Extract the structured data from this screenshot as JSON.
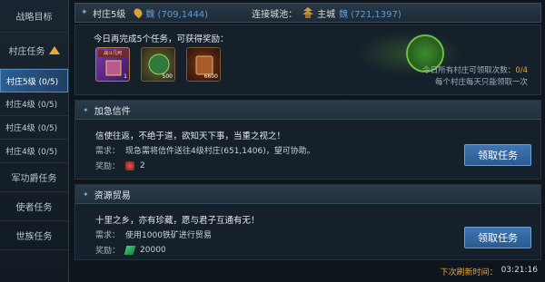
{
  "sidebar": {
    "items": [
      {
        "label": "战略目标"
      },
      {
        "label": "村庄任务"
      },
      {
        "label": "村庄5级 (0/5)",
        "active": true
      },
      {
        "label": "村庄4级 (0/5)"
      },
      {
        "label": "村庄4级 (0/5)"
      },
      {
        "label": "村庄4级 (0/5)"
      },
      {
        "label": "军功爵任务"
      },
      {
        "label": "使者任务"
      },
      {
        "label": "世族任务"
      }
    ]
  },
  "header": {
    "village": "村庄5级",
    "village_coord": "魏 (709,1444)",
    "connect_label": "连接城池：",
    "city": "主城",
    "city_coord": "魏 (721,1397)"
  },
  "daily": {
    "title": "今日再完成5个任务，可获得奖励：",
    "rewards": [
      {
        "label": "战斗几何",
        "count": "1"
      },
      {
        "label": "",
        "count": "500"
      },
      {
        "label": "",
        "count": "6600"
      }
    ],
    "count_label": "今日所有村庄可领取次数：",
    "count_value": "0/4",
    "note": "每个村庄每天只能领取一次"
  },
  "tasks": [
    {
      "title": "加急信件",
      "desc": "信使往返，不绝于道，欲知天下事，当重之视之！",
      "req_label": "需求：",
      "req_value": "现急需将信件送往4级村庄(651,1406)，望可协助。",
      "reward_label": "奖励：",
      "reward_value": "2",
      "button": "领取任务"
    },
    {
      "title": "资源贸易",
      "desc": "十里之乡，亦有珍藏，愿与君子互通有无！",
      "req_label": "需求：",
      "req_value": "使用1000铁矿进行贸易",
      "reward_label": "奖励：",
      "reward_value": "20000",
      "button": "领取任务"
    }
  ],
  "refresh": {
    "label": "下次刷新时间：",
    "time": "03:21:16"
  }
}
